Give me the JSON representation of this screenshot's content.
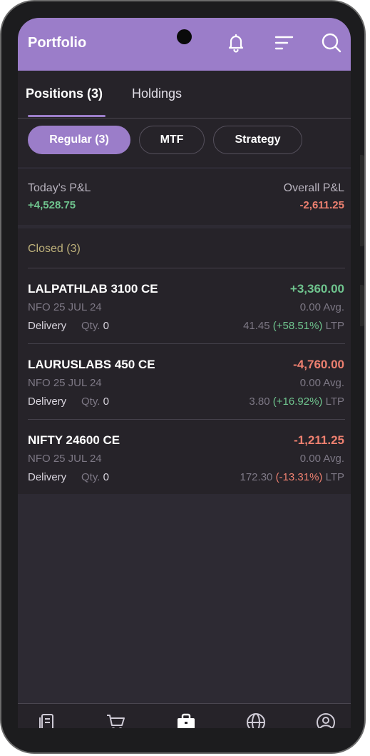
{
  "header": {
    "title": "Portfolio",
    "icons": [
      "bell-icon",
      "filter-sort-icon",
      "search-icon"
    ]
  },
  "tabs": [
    {
      "label": "Positions (3)",
      "active": true
    },
    {
      "label": "Holdings",
      "active": false
    }
  ],
  "filters": [
    {
      "label": "Regular (3)",
      "active": true
    },
    {
      "label": "MTF",
      "active": false
    },
    {
      "label": "Strategy",
      "active": false
    }
  ],
  "summary": {
    "today_label": "Today's P&L",
    "today_value": "+4,528.75",
    "overall_label": "Overall P&L",
    "overall_value": "-2,611.25"
  },
  "closed": {
    "heading": "Closed (3)",
    "rows": [
      {
        "name": "LALPATHLAB 3100 CE",
        "pnl": "+3,360.00",
        "exchange": "NFO 25 JUL 24",
        "avg": "0.00 Avg.",
        "product": "Delivery",
        "qty_label": "Qty.",
        "qty": "0",
        "ltp": "41.45",
        "change": "(+58.51%)",
        "ltp_suffix": "LTP"
      },
      {
        "name": "LAURUSLABS 450 CE",
        "pnl": "-4,760.00",
        "exchange": "NFO 25 JUL 24",
        "avg": "0.00 Avg.",
        "product": "Delivery",
        "qty_label": "Qty.",
        "qty": "0",
        "ltp": "3.80",
        "change": "(+16.92%)",
        "ltp_suffix": "LTP"
      },
      {
        "name": "NIFTY 24600 CE",
        "pnl": "-1,211.25",
        "exchange": "NFO 25 JUL 24",
        "avg": "0.00 Avg.",
        "product": "Delivery",
        "qty_label": "Qty.",
        "qty": "0",
        "ltp": "172.30",
        "change": "(-13.31%)",
        "ltp_suffix": "LTP"
      }
    ]
  },
  "bottom_nav": [
    "watchlist-icon",
    "orders-cart-icon",
    "portfolio-briefcase-icon",
    "globe-icon",
    "profile-icon"
  ],
  "colors": {
    "accent": "#9b7dc9",
    "positive": "#6fc48e",
    "negative": "#ee8070",
    "closed_heading": "#bdb07a"
  }
}
